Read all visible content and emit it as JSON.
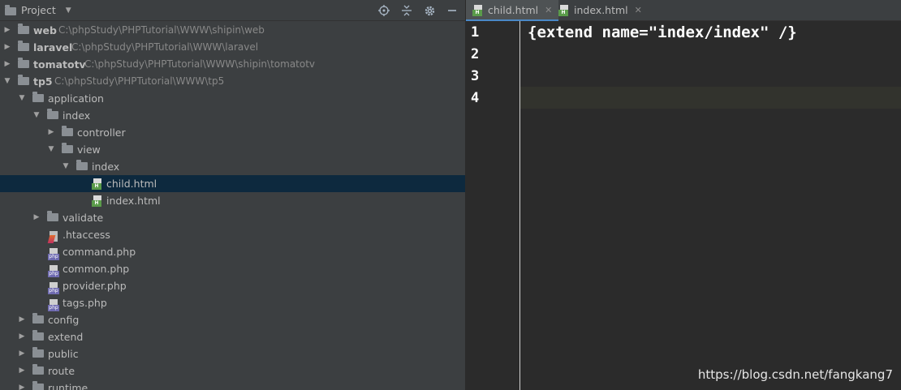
{
  "project_panel": {
    "title": "Project",
    "tree": [
      {
        "id": "web",
        "name": "web",
        "path": "C:\\phpStudy\\PHPTutorial\\WWW\\shipin\\web",
        "bold": true
      },
      {
        "id": "laravel",
        "name": "laravel",
        "path": "C:\\phpStudy\\PHPTutorial\\WWW\\laravel",
        "bold": true
      },
      {
        "id": "tomatotv",
        "name": "tomatotv",
        "path": "C:\\phpStudy\\PHPTutorial\\WWW\\shipin\\tomatotv",
        "bold": true
      },
      {
        "id": "tp5",
        "name": "tp5",
        "path": "C:\\phpStudy\\PHPTutorial\\WWW\\tp5",
        "bold": true
      },
      {
        "id": "application",
        "name": "application"
      },
      {
        "id": "index",
        "name": "index"
      },
      {
        "id": "controller",
        "name": "controller"
      },
      {
        "id": "view",
        "name": "view"
      },
      {
        "id": "view-index",
        "name": "index"
      },
      {
        "id": "child-html",
        "name": "child.html"
      },
      {
        "id": "index-html",
        "name": "index.html"
      },
      {
        "id": "validate",
        "name": "validate"
      },
      {
        "id": "htaccess",
        "name": ".htaccess"
      },
      {
        "id": "command-php",
        "name": "command.php"
      },
      {
        "id": "common-php",
        "name": "common.php"
      },
      {
        "id": "provider-php",
        "name": "provider.php"
      },
      {
        "id": "tags-php",
        "name": "tags.php"
      },
      {
        "id": "config",
        "name": "config"
      },
      {
        "id": "extend",
        "name": "extend"
      },
      {
        "id": "public",
        "name": "public"
      },
      {
        "id": "route",
        "name": "route"
      },
      {
        "id": "runtime",
        "name": "runtime"
      }
    ]
  },
  "editor": {
    "tabs": [
      {
        "label": "child.html",
        "active": true
      },
      {
        "label": "index.html",
        "active": false
      }
    ],
    "line_numbers": [
      "1",
      "2",
      "3",
      "4"
    ],
    "code_lines": [
      "{extend name=\"index/index\" /}",
      "",
      "",
      ""
    ]
  },
  "watermark": "https://blog.csdn.net/fangkang7",
  "colors": {
    "panel_bg": "#3c3f41",
    "editor_bg": "#2b2b2b",
    "selection": "#0d293e",
    "tab_accent": "#4a88c7"
  }
}
